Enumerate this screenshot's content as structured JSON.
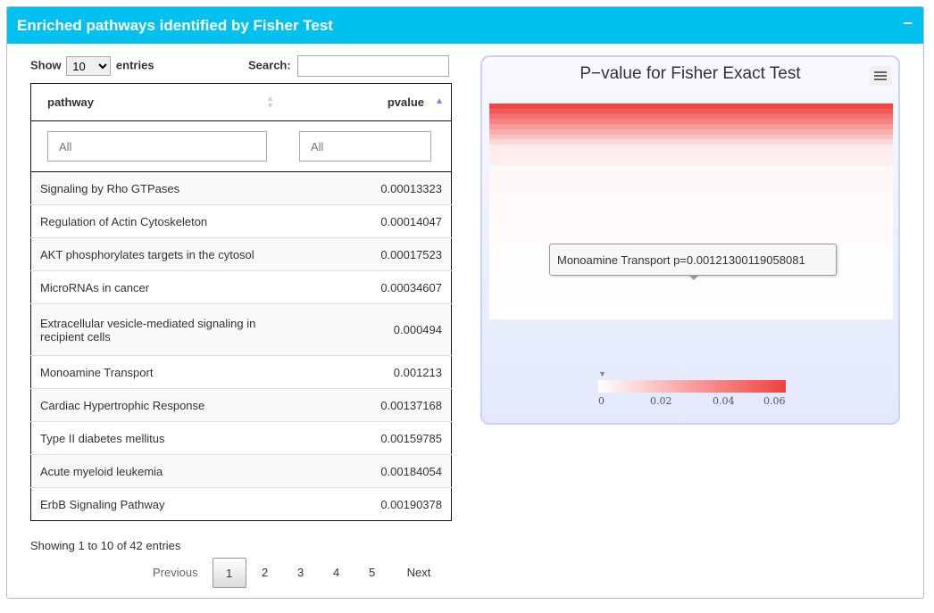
{
  "box": {
    "title": "Enriched pathways identified by Fisher Test",
    "collapse_label": "−"
  },
  "table": {
    "show_label": "Show",
    "entries_label": "entries",
    "length_value": "10",
    "search_label": "Search:",
    "search_value": "",
    "columns": [
      "pathway",
      "pvalue"
    ],
    "filter_placeholders": [
      "All",
      "All"
    ],
    "rows": [
      {
        "pathway": "Signaling by Rho GTPases",
        "pvalue": "0.00013323"
      },
      {
        "pathway": "Regulation of Actin Cytoskeleton",
        "pvalue": "0.00014047"
      },
      {
        "pathway": "AKT phosphorylates targets in the cytosol",
        "pvalue": "0.00017523"
      },
      {
        "pathway": "MicroRNAs in cancer",
        "pvalue": "0.00034607"
      },
      {
        "pathway": "Extracellular vesicle-mediated signaling in recipient cells",
        "pvalue": "0.000494"
      },
      {
        "pathway": "Monoamine Transport",
        "pvalue": "0.001213"
      },
      {
        "pathway": "Cardiac Hypertrophic Response",
        "pvalue": "0.00137168"
      },
      {
        "pathway": "Type II diabetes mellitus",
        "pvalue": "0.00159785"
      },
      {
        "pathway": "Acute myeloid leukemia",
        "pvalue": "0.00184054"
      },
      {
        "pathway": "ErbB Signaling Pathway",
        "pvalue": "0.00190378"
      }
    ],
    "info": "Showing 1 to 10 of 42 entries",
    "pager": {
      "previous": "Previous",
      "pages": [
        "1",
        "2",
        "3",
        "4",
        "5"
      ],
      "current": "1",
      "next": "Next"
    }
  },
  "chart": {
    "title": "P−value for Fisher Exact Test",
    "tooltip": "Monoamine Transport p=0.00121300119058081",
    "colors": {
      "low": "#ffffff",
      "high": "#f04040"
    }
  },
  "chart_data": {
    "type": "heatmap",
    "title": "P−value for Fisher Exact Test",
    "color_axis": {
      "min": 0,
      "max": 0.07,
      "ticks": [
        "0",
        "0.02",
        "0.04",
        "0.06"
      ]
    },
    "tooltip_point": {
      "name": "Monoamine Transport",
      "value": 0.00121300119058081
    }
  }
}
